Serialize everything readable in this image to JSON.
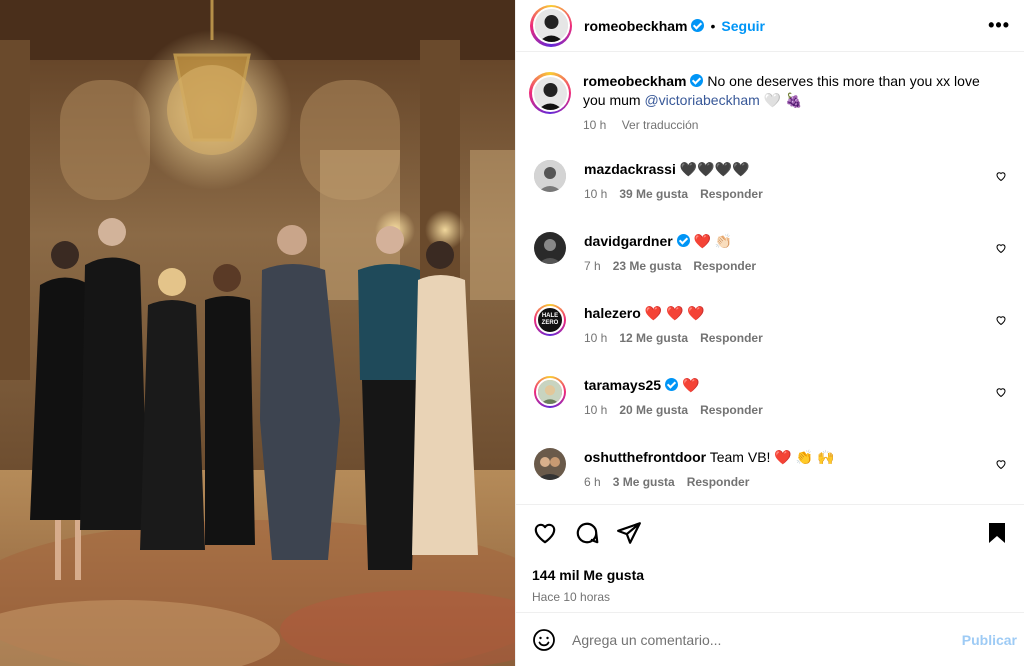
{
  "header": {
    "username": "romeobeckham",
    "separator": "•",
    "follow_label": "Seguir",
    "more_label": "•••"
  },
  "caption": {
    "username": "romeobeckham",
    "text_before": " No one deserves this more than you xx love you mum ",
    "mention": "@victoriabeckham",
    "emoji": " 🤍 🍇",
    "time": "10 h",
    "translate": "Ver traducción"
  },
  "comments": [
    {
      "username": "mazdackrassi",
      "text": " 🖤🖤🖤🖤",
      "verified": false,
      "time": "10 h",
      "likes": "39 Me gusta",
      "reply": "Responder"
    },
    {
      "username": "davidgardner",
      "text": " ❤️ 👏🏻",
      "verified": true,
      "time": "7 h",
      "likes": "23 Me gusta",
      "reply": "Responder"
    },
    {
      "username": "halezero",
      "text": " ❤️ ❤️ ❤️",
      "verified": false,
      "time": "10 h",
      "likes": "12 Me gusta",
      "reply": "Responder",
      "avatar_text": "HALE ZERO"
    },
    {
      "username": "taramays25",
      "text": " ❤️",
      "verified": true,
      "time": "10 h",
      "likes": "20 Me gusta",
      "reply": "Responder"
    },
    {
      "username": "oshutthefrontdoor",
      "text": " Team VB! ❤️ 👏 🙌",
      "verified": false,
      "time": "6 h",
      "likes": "3 Me gusta",
      "reply": "Responder"
    }
  ],
  "actions": {
    "likes": "144 mil Me gusta",
    "time": "Hace 10 horas"
  },
  "add_comment": {
    "placeholder": "Agrega un comentario...",
    "post_label": "Publicar"
  },
  "colors": {
    "accent": "#0095f6",
    "mention": "#385898",
    "muted": "#737373",
    "post_disabled": "#9ecbf5"
  }
}
